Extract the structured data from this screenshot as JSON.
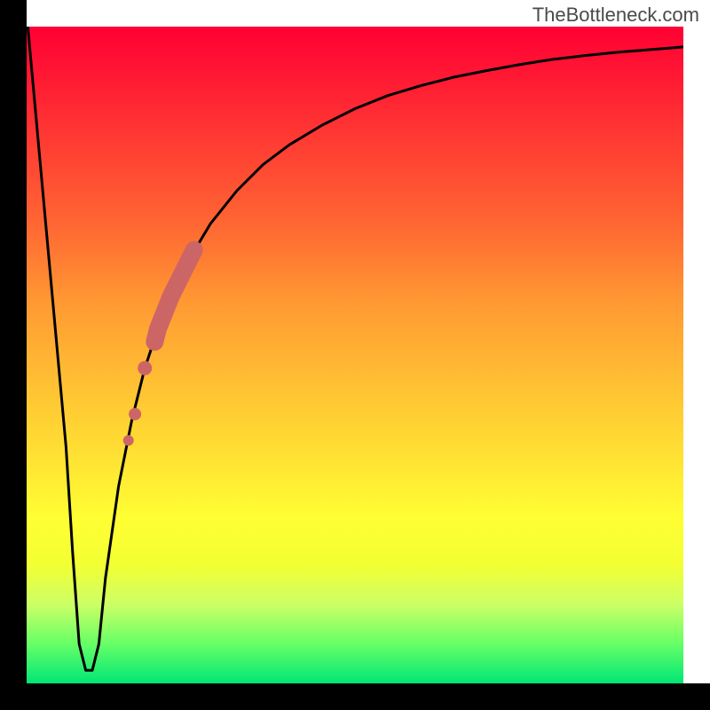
{
  "watermark": "TheBottleneck.com",
  "chart_data": {
    "type": "line",
    "title": "",
    "xlabel": "",
    "ylabel": "",
    "xlim": [
      0,
      100
    ],
    "ylim": [
      0,
      100
    ],
    "series": [
      {
        "name": "bottleneck-curve",
        "x": [
          0,
          2,
          4,
          6,
          7,
          8,
          9,
          10,
          11,
          12,
          14,
          16,
          18,
          20,
          22,
          25,
          28,
          32,
          36,
          40,
          45,
          50,
          55,
          60,
          65,
          70,
          75,
          80,
          85,
          90,
          95,
          100
        ],
        "y": [
          102,
          80,
          58,
          36,
          20,
          6,
          2,
          2,
          6,
          16,
          30,
          40,
          48,
          54,
          59,
          65,
          70,
          75,
          79,
          82,
          85,
          87.5,
          89.5,
          91,
          92.3,
          93.3,
          94.2,
          95,
          95.6,
          96.1,
          96.5,
          96.9
        ]
      }
    ],
    "highlight": {
      "name": "bottleneck-segment",
      "color": "#cc6666",
      "points_x": [
        15.5,
        16.5,
        18,
        19.5,
        20,
        22,
        24,
        25.5
      ],
      "points_y": [
        37,
        41,
        48,
        52,
        54,
        59,
        63,
        66
      ]
    },
    "gradient_stops": [
      {
        "pos": 0,
        "color": "#ff0033"
      },
      {
        "pos": 0.3,
        "color": "#ff6633"
      },
      {
        "pos": 0.55,
        "color": "#ffc233"
      },
      {
        "pos": 0.75,
        "color": "#ffff33"
      },
      {
        "pos": 0.94,
        "color": "#66ff66"
      },
      {
        "pos": 1.0,
        "color": "#00e676"
      }
    ]
  }
}
